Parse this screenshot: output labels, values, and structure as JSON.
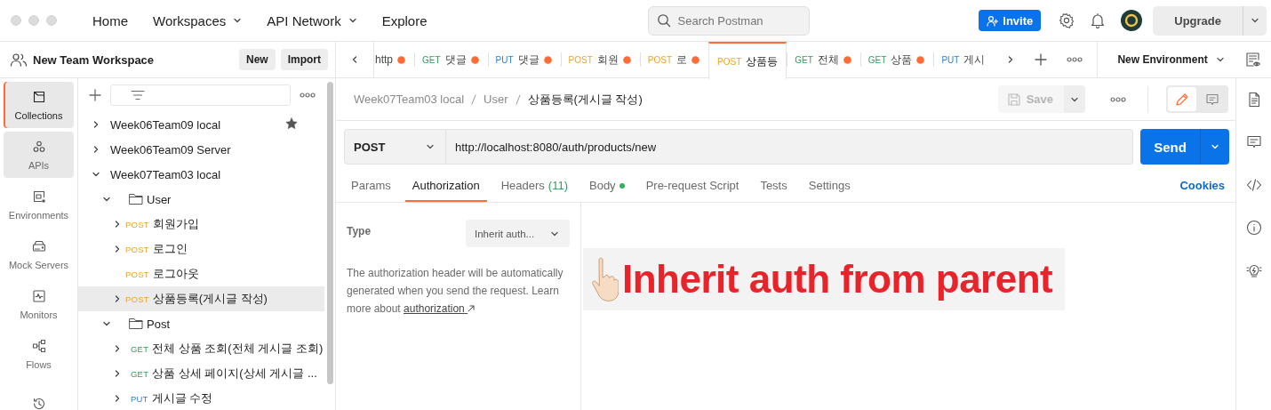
{
  "nav": [
    {
      "label": "Home",
      "dropdown": false
    },
    {
      "label": "Workspaces",
      "dropdown": true
    },
    {
      "label": "API Network",
      "dropdown": true
    },
    {
      "label": "Explore",
      "dropdown": false
    }
  ],
  "search": {
    "placeholder": "Search Postman"
  },
  "invite_button": "Invite",
  "upgrade_button": "Upgrade",
  "workspace": {
    "name": "New Team Workspace",
    "buttons": [
      "New",
      "Import"
    ]
  },
  "sidebar_nav": [
    {
      "label": "Collections",
      "selected": true,
      "highlighted": true
    },
    {
      "label": "APIs",
      "selected": false,
      "highlighted": true
    },
    {
      "label": "Environments",
      "selected": false,
      "highlighted": false
    },
    {
      "label": "Mock Servers",
      "selected": false,
      "highlighted": false
    },
    {
      "label": "Monitors",
      "selected": false,
      "highlighted": false
    },
    {
      "label": "Flows",
      "selected": false,
      "highlighted": false
    },
    {
      "selected": false,
      "highlighted": false
    }
  ],
  "tree": [
    {
      "kind": "collection",
      "label": "Week06Team09 local",
      "expanded": false,
      "starred": true,
      "selected": false
    },
    {
      "kind": "collection",
      "label": "Week06Team09 Server",
      "expanded": false,
      "starred": false,
      "selected": false
    },
    {
      "kind": "collection",
      "label": "Week07Team03 local",
      "expanded": true,
      "starred": false,
      "selected": false,
      "children": [
        {
          "kind": "folder",
          "label": "User",
          "expanded": true,
          "selected": false,
          "children": [
            {
              "kind": "request",
              "method": "POST",
              "label": "회원가입",
              "expanded": false,
              "selected": false
            },
            {
              "kind": "request",
              "method": "POST",
              "label": "로그인",
              "expanded": false,
              "selected": false
            },
            {
              "kind": "request",
              "method": "POST",
              "label": "로그아웃",
              "selected": false
            },
            {
              "kind": "request",
              "method": "POST",
              "label": "상품등록(게시글 작성)",
              "expanded": false,
              "selected": true
            }
          ]
        },
        {
          "kind": "folder",
          "label": "Post",
          "expanded": true,
          "selected": false,
          "children": [
            {
              "kind": "request",
              "method": "GET",
              "label": "전체 상품 조회(전체 게시글 조회)",
              "expanded": false,
              "selected": false
            },
            {
              "kind": "request",
              "method": "GET",
              "label": "상품 상세 페이지(상세 게시글 ...",
              "expanded": false,
              "selected": false
            },
            {
              "kind": "request",
              "method": "PUT",
              "label": "게시글 수정",
              "expanded": false,
              "selected": false
            }
          ]
        }
      ]
    }
  ],
  "tabs": [
    {
      "label": "http",
      "unsaved": true,
      "selected": false
    },
    {
      "method": "GET",
      "label": "댓글",
      "unsaved": true,
      "selected": false
    },
    {
      "method": "PUT",
      "label": "댓글",
      "unsaved": true,
      "selected": false
    },
    {
      "method": "POST",
      "label": "회원",
      "unsaved": true,
      "selected": false
    },
    {
      "method": "POST",
      "label": "로",
      "unsaved": true,
      "selected": false
    },
    {
      "method": "POST",
      "label": "상품등",
      "unsaved": false,
      "selected": true
    },
    {
      "method": "GET",
      "label": "전체",
      "unsaved": true,
      "selected": false
    },
    {
      "method": "GET",
      "label": "상품",
      "unsaved": true,
      "selected": false
    },
    {
      "method": "PUT",
      "label": "게시",
      "unsaved": false,
      "selected": false
    }
  ],
  "environment": {
    "label": "New Environment"
  },
  "breadcrumb": [
    "Week07Team03 local",
    "User",
    "상품등록(게시글 작성)"
  ],
  "save_button": {
    "label": "Save",
    "disabled": true
  },
  "request": {
    "method": "POST",
    "url": "http://localhost:8080/auth/products/new",
    "send_button": "Send"
  },
  "request_tabs": [
    {
      "label": "Params",
      "selected": false
    },
    {
      "label": "Authorization",
      "selected": true
    },
    {
      "label": "Headers",
      "count": "(11)",
      "selected": false
    },
    {
      "label": "Body",
      "dot": true,
      "selected": false
    },
    {
      "label": "Pre-request Script",
      "selected": false
    },
    {
      "label": "Tests",
      "selected": false
    },
    {
      "label": "Settings",
      "selected": false
    }
  ],
  "cookies_link": "Cookies",
  "auth": {
    "type_label": "Type",
    "type_value": "Inherit auth...",
    "description": "The authorization header will be automatically generated when you send the request. Learn more about",
    "link": "authorization"
  },
  "annotation": {
    "text": "Inherit auth from parent"
  }
}
